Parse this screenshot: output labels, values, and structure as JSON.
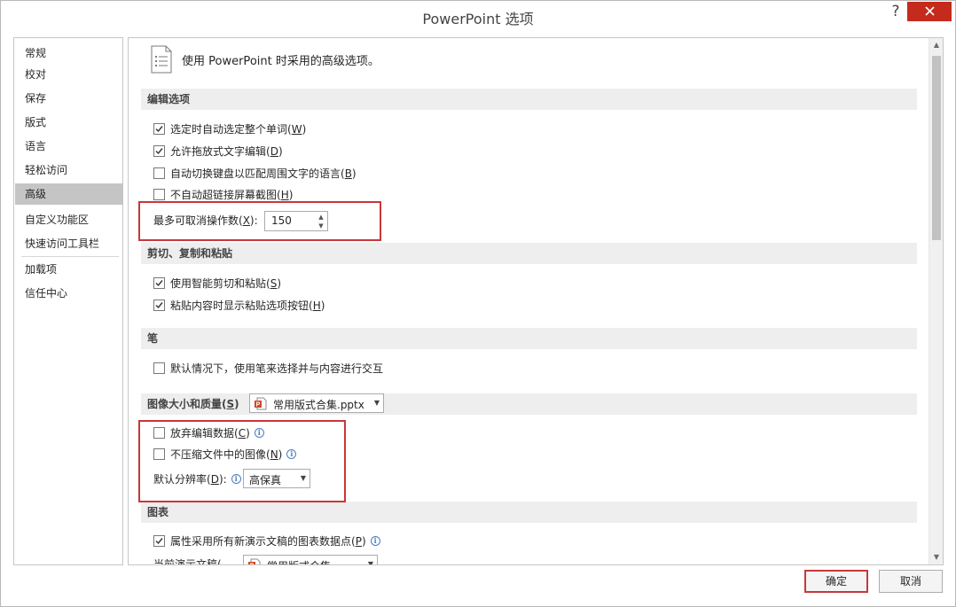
{
  "window": {
    "title": "PowerPoint 选项",
    "help_label": "?"
  },
  "nav": {
    "items": [
      {
        "label": "常规"
      },
      {
        "label": "校对"
      },
      {
        "label": "保存"
      },
      {
        "label": "版式"
      },
      {
        "label": "语言"
      },
      {
        "label": "轻松访问"
      },
      {
        "label": "高级",
        "selected": true
      },
      {
        "label": "自定义功能区"
      },
      {
        "label": "快速访问工具栏"
      },
      {
        "label": "加载项"
      },
      {
        "label": "信任中心"
      }
    ]
  },
  "content": {
    "header": "使用 PowerPoint 时采用的高级选项。",
    "edit": {
      "title": "编辑选项",
      "opt1": {
        "label": "选定时自动选定整个单词(",
        "key": "W",
        "checked": true
      },
      "opt2": {
        "label": "允许拖放式文字编辑(",
        "key": "D",
        "checked": true
      },
      "opt3": {
        "label": "自动切换键盘以匹配周围文字的语言(",
        "key": "B",
        "checked": false
      },
      "opt4": {
        "label": "不自动超链接屏幕截图(",
        "key": "H",
        "checked": false
      },
      "undo_label": "最多可取消操作数(",
      "undo_key": "X",
      "undo_suffix": "):",
      "undo_value": "150"
    },
    "cut": {
      "title": "剪切、复制和粘贴",
      "opt1": {
        "label": "使用智能剪切和粘贴(",
        "key": "S",
        "checked": true
      },
      "opt2": {
        "label": "粘贴内容时显示粘贴选项按钮(",
        "key": "H",
        "checked": true
      }
    },
    "pen": {
      "title": "笔",
      "opt1": {
        "label": "默认情况下，使用笔来选择并与内容进行交互",
        "checked": false
      }
    },
    "image": {
      "title": "图像大小和质量(",
      "title_key": "S",
      "file": "常用版式合集.pptx",
      "opt1": {
        "label": "放弃编辑数据(",
        "key": "C",
        "checked": false
      },
      "opt2": {
        "label": "不压缩文件中的图像(",
        "key": "N",
        "checked": false
      },
      "res_label": "默认分辨率(",
      "res_key": "D",
      "res_suffix": "):",
      "res_value": "高保真"
    },
    "chart": {
      "title": "图表",
      "opt1": {
        "label": "属性采用所有新演示文稿的图表数据点(",
        "key": "P",
        "checked": true
      },
      "partial_label": "当前演示文稿(",
      "partial_file": "常用版式合集"
    }
  },
  "footer": {
    "ok": "确定",
    "cancel": "取消"
  },
  "colors": {
    "accent_highlight": "#c9373a",
    "selected_nav": "#c5c5c5",
    "section_bg": "#eeeeee",
    "close_btn": "#c42b1c"
  }
}
